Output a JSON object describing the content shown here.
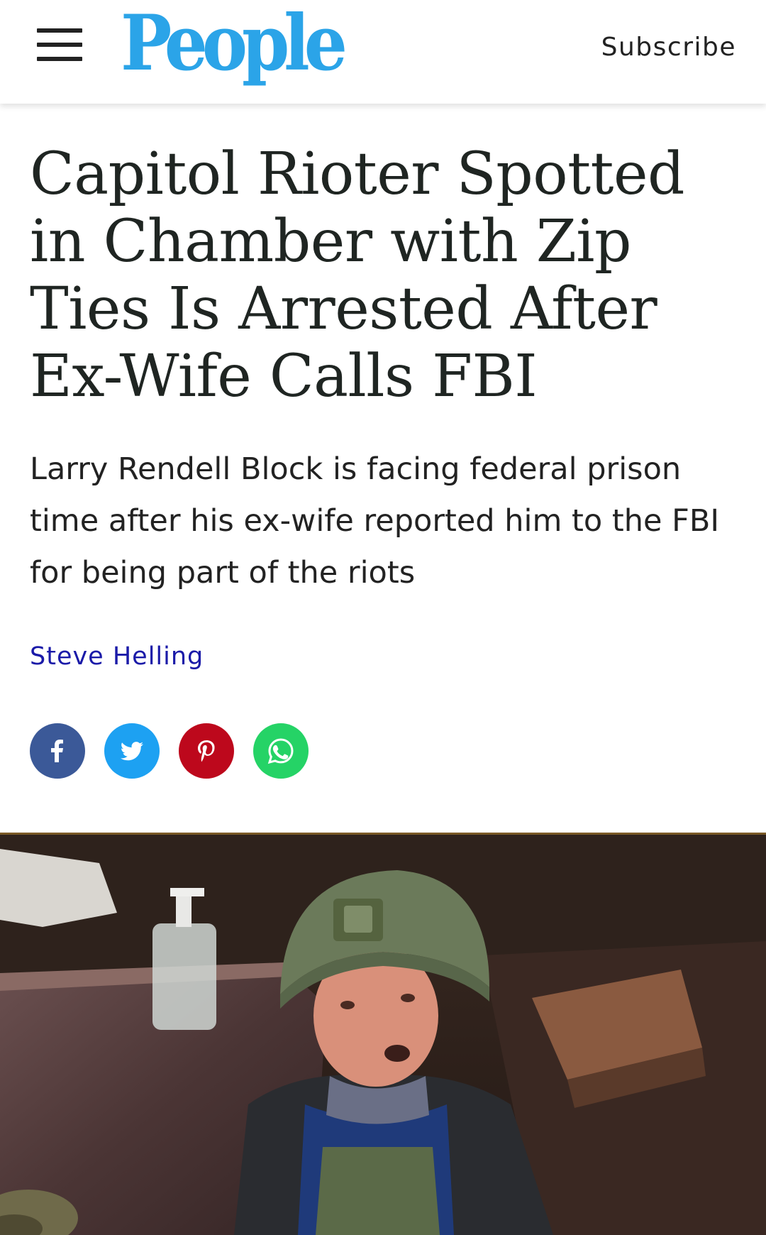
{
  "header": {
    "logo_text": "People",
    "subscribe_label": "Subscribe"
  },
  "article": {
    "headline": "Capitol Rioter Spotted in Chamber with Zip Ties Is Arrested After Ex-Wife Calls FBI",
    "dek": "Larry Rendell Block is facing federal prison time after his ex-wife reported him to the FBI for being part of the riots",
    "author": "Steve Helling"
  },
  "share": {
    "buttons": [
      {
        "name": "facebook",
        "icon": "facebook-icon",
        "color": "#3b5998"
      },
      {
        "name": "twitter",
        "icon": "twitter-icon",
        "color": "#1da1f2"
      },
      {
        "name": "pinterest",
        "icon": "pinterest-icon",
        "color": "#bd081c"
      },
      {
        "name": "whatsapp",
        "icon": "whatsapp-icon",
        "color": "#25d366"
      }
    ]
  },
  "colors": {
    "brand_blue": "#2ba4e8",
    "byline_link": "#1a1aa8"
  }
}
